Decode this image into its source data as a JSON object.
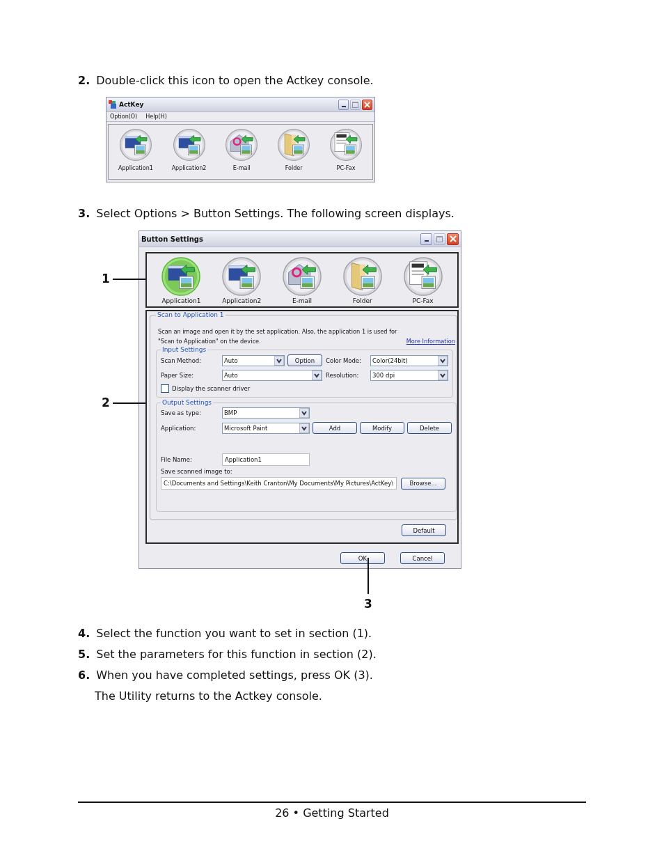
{
  "steps_before": [
    {
      "number": "2.",
      "text": "Double-click this icon to open the Actkey console."
    }
  ],
  "actkey_window": {
    "title": "ActKey",
    "menu": [
      "Option(O)",
      "Help(H)"
    ],
    "buttons": [
      {
        "label": "Application1",
        "kind": "app"
      },
      {
        "label": "Application2",
        "kind": "app"
      },
      {
        "label": "E-mail",
        "kind": "email"
      },
      {
        "label": "Folder",
        "kind": "folder"
      },
      {
        "label": "PC-Fax",
        "kind": "fax"
      }
    ]
  },
  "step_3": {
    "number": "3.",
    "text": "Select Options > Button Settings. The following screen displays."
  },
  "button_settings": {
    "title": "Button Settings",
    "buttons": [
      {
        "label": "Application1",
        "kind": "app",
        "selected": true
      },
      {
        "label": "Application2",
        "kind": "app",
        "selected": false
      },
      {
        "label": "E-mail",
        "kind": "email",
        "selected": false
      },
      {
        "label": "Folder",
        "kind": "folder",
        "selected": false
      },
      {
        "label": "PC-Fax",
        "kind": "fax",
        "selected": false
      }
    ],
    "group_title": "Scan to Application 1",
    "description": "Scan an image and open it by the set application. Also, the application 1 is used for \"Scan to Application\" on the device.",
    "more_information": "More Information",
    "input_settings": {
      "title": "Input Settings",
      "scan_method": {
        "label": "Scan Method:",
        "value": "Auto"
      },
      "option_button": "Option",
      "color_mode": {
        "label": "Color Mode:",
        "value": "Color(24bit)"
      },
      "paper_size": {
        "label": "Paper Size:",
        "value": "Auto"
      },
      "resolution": {
        "label": "Resolution:",
        "value": "300 dpi"
      },
      "display_driver": {
        "label": "Display the scanner driver",
        "checked": false
      }
    },
    "output_settings": {
      "title": "Output Settings",
      "save_as_type": {
        "label": "Save as type:",
        "value": "BMP"
      },
      "application": {
        "label": "Application:",
        "value": "Microsoft Paint"
      },
      "add_button": "Add",
      "modify_button": "Modify",
      "delete_button": "Delete",
      "file_name": {
        "label": "File Name:",
        "value": "Application1"
      },
      "save_to_label": "Save scanned image to:",
      "save_to_path": "C:\\Documents and Settings\\Keith Cranton\\My Documents\\My Pictures\\ActKey\\",
      "browse_button": "Browse..."
    },
    "default_button": "Default",
    "ok_button": "OK",
    "cancel_button": "Cancel"
  },
  "callouts": [
    "1",
    "2",
    "3"
  ],
  "steps_after": [
    {
      "number": "4.",
      "text": "Select the function you want to set in section (1)."
    },
    {
      "number": "5.",
      "text": "Set the parameters for this function in section (2)."
    },
    {
      "number": "6.",
      "text": "When you have completed settings, press OK (3)."
    }
  ],
  "closing": "The Utility returns to the Actkey console.",
  "footer": "26 • Getting Started"
}
